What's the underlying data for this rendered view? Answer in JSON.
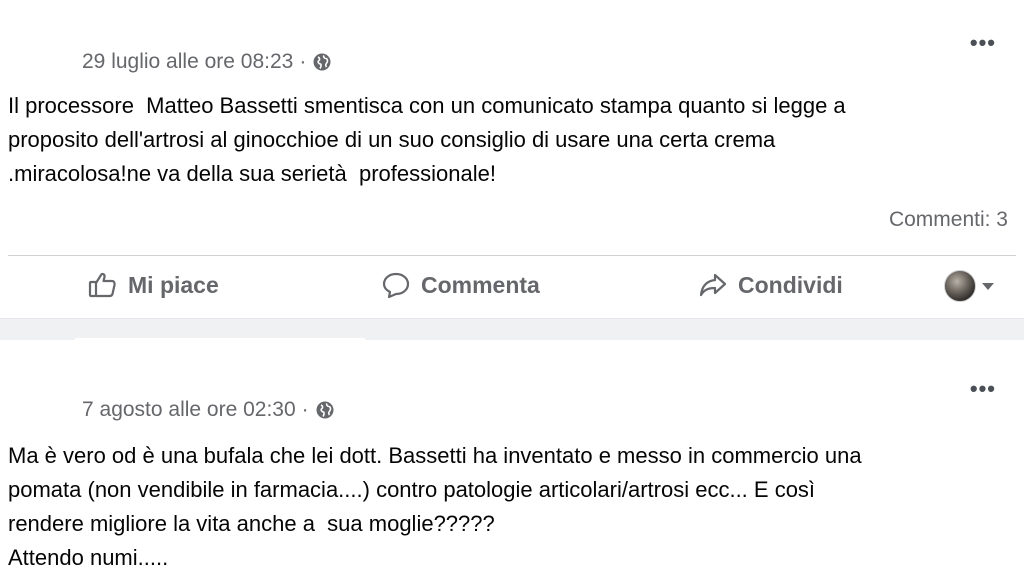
{
  "posts": [
    {
      "timestamp": "29 luglio alle ore 08:23",
      "separator": "·",
      "privacy_icon": "globe-icon",
      "text": "Il processore  Matteo Bassetti smentisca con un comunicato stampa quanto si legge a\nproposito dell'artrosi al ginocchioe di un suo consiglio di usare una certa crema\n.miracolosa!ne va della sua serietà  professionale!",
      "comments": "Commenti: 3",
      "actions": {
        "like": "Mi piace",
        "comment": "Commenta",
        "share": "Condividi"
      }
    },
    {
      "timestamp": "7 agosto alle ore 02:30",
      "separator": "·",
      "privacy_icon": "globe-icon",
      "text": "Ma è vero od è una bufala che lei dott. Bassetti ha inventato e messo in commercio una\npomata (non vendibile in farmacia....) contro patologie articolari/artrosi ecc... E così\nrendere migliore la vita anche a  sua moglie?????\nAttendo numi....."
    }
  ],
  "more_label": "•••",
  "colors": {
    "secondary_text": "#65676b",
    "primary_text": "#050505",
    "divider": "#ced0d4",
    "separator_bg": "#f0f1f3"
  }
}
